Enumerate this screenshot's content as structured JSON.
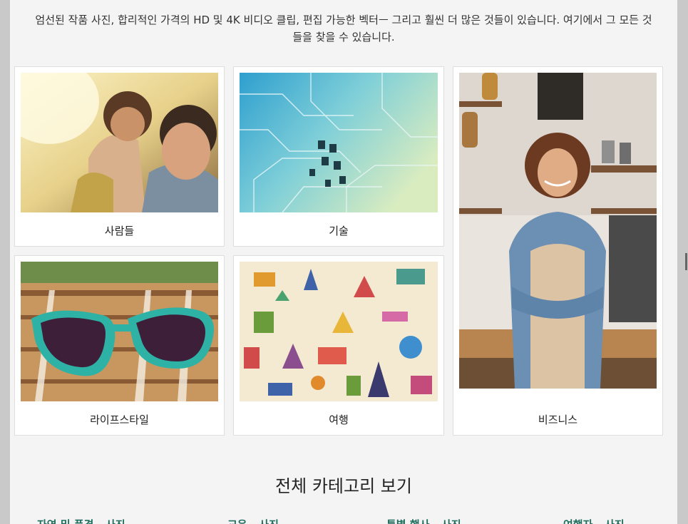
{
  "intro": {
    "line1": "엄선된 작품 사진, 합리적인 가격의 HD 및 4K 비디오 클립, 편집 가능한 벡터ㅡ 그리고 훨씬 더 많은 것들이 있습니다. 여기에서 그 모든 것",
    "line2": "들을 찾을 수 있습니다."
  },
  "categories": [
    {
      "label": "사람들"
    },
    {
      "label": "기술"
    },
    {
      "label": "비즈니스"
    },
    {
      "label": "라이프스타일"
    },
    {
      "label": "여행"
    }
  ],
  "all_categories_heading": "전체 카테고리 보기",
  "category_links": [
    {
      "label": "자연 및 풍경 - 사진"
    },
    {
      "label": "교육 - 사진"
    },
    {
      "label": "특별 행사 - 사진"
    },
    {
      "label": "여행자 - 사진"
    }
  ],
  "colors": {
    "link": "#1f6e5e",
    "panel": "#f4f4f4",
    "frame": "#c9c9c9"
  }
}
